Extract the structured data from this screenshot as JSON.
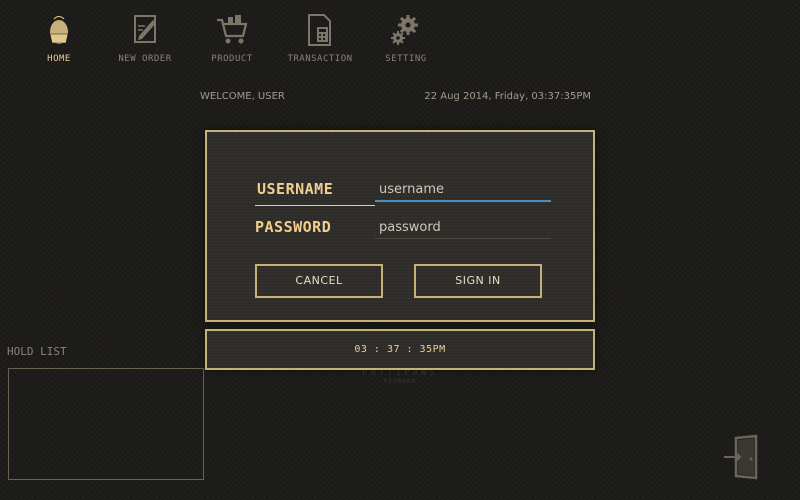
{
  "nav": {
    "items": [
      {
        "label": "HOME",
        "icon": "home-egg-icon",
        "active": true
      },
      {
        "label": "NEW ORDER",
        "icon": "new-order-icon",
        "active": false
      },
      {
        "label": "PRODUCT",
        "icon": "cart-icon",
        "active": false
      },
      {
        "label": "TRANSACTION",
        "icon": "calculator-icon",
        "active": false
      },
      {
        "label": "SETTING",
        "icon": "gear-icon",
        "active": false
      }
    ]
  },
  "header": {
    "welcome": "WELCOME, USER",
    "datetime": "22 Aug 2014, Friday, 03:37:35PM"
  },
  "login": {
    "username_label": "USERNAME",
    "password_label": "PASSWORD",
    "username_placeholder": "username",
    "password_placeholder": "password",
    "username_value": "",
    "password_value": "",
    "cancel_label": "CANCEL",
    "signin_label": "SIGN IN"
  },
  "clock": {
    "time": "03 : 37 : 35PM"
  },
  "hold_list": {
    "title": "HOLD LIST",
    "items": []
  },
  "logo": {
    "main": "PATTIPAWS",
    "sub": "PETROOM"
  },
  "colors": {
    "accent": "#c8b07a",
    "label": "#f0cf8f",
    "background": "#1b1a18",
    "focus": "#4a8fc4"
  }
}
